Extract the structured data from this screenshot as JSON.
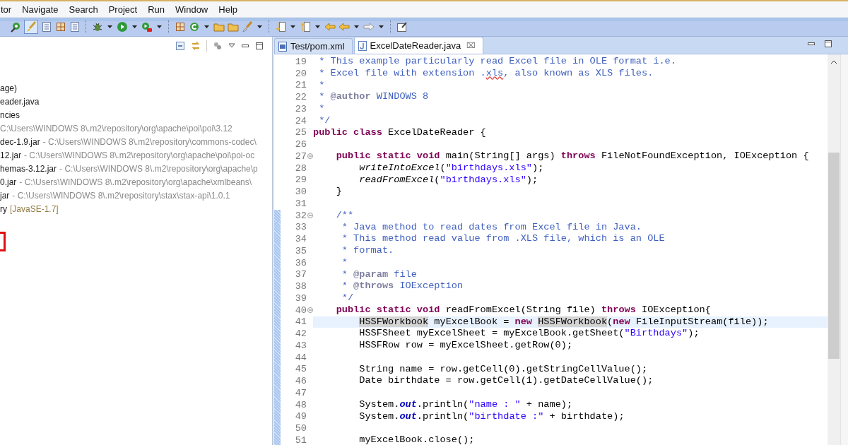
{
  "menu_bar": {
    "items": [
      "tor",
      "Navigate",
      "Search",
      "Project",
      "Run",
      "Window",
      "Help"
    ]
  },
  "project_explorer": {
    "items": [
      {
        "label": "age)"
      },
      {
        "label": "eader.java"
      },
      {
        "label": "ncies"
      },
      {
        "detail": "C:\\Users\\WINDOWS 8\\.m2\\repository\\org\\apache\\poi\\poi\\3.12",
        "kind": "path"
      },
      {
        "label": "dec-1.9.jar",
        "detail": "- C:\\Users\\WINDOWS 8\\.m2\\repository\\commons-codec\\",
        "kind": "path"
      },
      {
        "label": "12.jar",
        "detail": "- C:\\Users\\WINDOWS 8\\.m2\\repository\\org\\apache\\poi\\poi-oc",
        "kind": "path"
      },
      {
        "label": "hemas-3.12.jar",
        "detail": "- C:\\Users\\WINDOWS 8\\.m2\\repository\\org\\apache\\p",
        "kind": "path"
      },
      {
        "label": "0.jar",
        "detail": "- C:\\Users\\WINDOWS 8\\.m2\\repository\\org\\apache\\xmlbeans\\",
        "kind": "path"
      },
      {
        "label": "jar",
        "detail": "- C:\\Users\\WINDOWS 8\\.m2\\repository\\stax\\stax-api\\1.0.1",
        "kind": "path"
      },
      {
        "label": "ry",
        "detail": "[JavaSE-1.7]",
        "kind": "library"
      }
    ]
  },
  "editor": {
    "tabs": [
      {
        "label": "Test/pom.xml",
        "kind": "xml",
        "selected": false
      },
      {
        "label": "ExcelDateReader.java",
        "kind": "java",
        "selected": true,
        "close": "⌧"
      }
    ],
    "lines": [
      {
        "number": "19",
        "fold": false,
        "changed": false,
        "current": false,
        "tokens": [
          {
            "kind": "comment",
            "text": " * This example particularly read Excel file in OLE format i.e."
          }
        ]
      },
      {
        "number": "20",
        "fold": false,
        "changed": false,
        "current": false,
        "tokens": [
          {
            "kind": "comment",
            "text": " * Excel file with extension ."
          },
          {
            "kind": "misspelled",
            "text": "xls"
          },
          {
            "kind": "comment",
            "text": ", also known as XLS files."
          }
        ]
      },
      {
        "number": "21",
        "fold": false,
        "changed": false,
        "current": false,
        "tokens": [
          {
            "kind": "comment",
            "text": " *"
          }
        ]
      },
      {
        "number": "22",
        "fold": false,
        "changed": false,
        "current": false,
        "tokens": [
          {
            "kind": "comment",
            "text": " * "
          },
          {
            "kind": "doc_tag",
            "text": "@author"
          },
          {
            "kind": "comment",
            "text": " WINDOWS 8"
          }
        ]
      },
      {
        "number": "23",
        "fold": false,
        "changed": false,
        "current": false,
        "tokens": [
          {
            "kind": "comment",
            "text": " *"
          }
        ]
      },
      {
        "number": "24",
        "fold": false,
        "changed": false,
        "current": false,
        "tokens": [
          {
            "kind": "comment",
            "text": " */"
          }
        ]
      },
      {
        "number": "25",
        "fold": false,
        "changed": false,
        "current": false,
        "tokens": [
          {
            "kind": "keyword",
            "text": "public"
          },
          {
            "kind": "keyword",
            "text": " class"
          },
          {
            "kind": "plain",
            "text": " ExcelDateReader {"
          }
        ]
      },
      {
        "number": "26",
        "fold": false,
        "changed": false,
        "current": false
      },
      {
        "number": "27",
        "fold": true,
        "changed": false,
        "current": false,
        "tokens": [
          {
            "kind": "keyword",
            "text": "    public"
          },
          {
            "kind": "keyword",
            "text": " static"
          },
          {
            "kind": "keyword",
            "text": " void"
          },
          {
            "kind": "plain",
            "text": " main(String[] args) "
          },
          {
            "kind": "keyword",
            "text": "throws"
          },
          {
            "kind": "plain",
            "text": " FileNotFoundException, IOException {"
          }
        ]
      },
      {
        "number": "28",
        "fold": false,
        "changed": false,
        "current": false,
        "tokens": [
          {
            "kind": "static_call",
            "text": "        writeIntoExcel"
          },
          {
            "kind": "plain",
            "text": "("
          },
          {
            "kind": "string",
            "text": "\"birthdays.xls\""
          },
          {
            "kind": "plain",
            "text": ");"
          }
        ]
      },
      {
        "number": "29",
        "fold": false,
        "changed": false,
        "current": false,
        "tokens": [
          {
            "kind": "static_call",
            "text": "        readFromExcel"
          },
          {
            "kind": "plain",
            "text": "("
          },
          {
            "kind": "string",
            "text": "\"birthdays.xls\""
          },
          {
            "kind": "plain",
            "text": ");"
          }
        ]
      },
      {
        "number": "30",
        "fold": false,
        "changed": false,
        "current": false,
        "tokens": [
          {
            "kind": "plain",
            "text": "    }"
          }
        ]
      },
      {
        "number": "31",
        "fold": false,
        "changed": false,
        "current": false
      },
      {
        "number": "32",
        "fold": true,
        "changed": true,
        "current": false,
        "tokens": [
          {
            "kind": "comment",
            "text": "    /**"
          }
        ]
      },
      {
        "number": "33",
        "fold": false,
        "changed": true,
        "current": false,
        "tokens": [
          {
            "kind": "comment",
            "text": "     * Java method to read dates from Excel file in Java."
          }
        ]
      },
      {
        "number": "34",
        "fold": false,
        "changed": true,
        "current": false,
        "tokens": [
          {
            "kind": "comment",
            "text": "     * This method read value from .XLS file, which is an OLE"
          }
        ]
      },
      {
        "number": "35",
        "fold": false,
        "changed": true,
        "current": false,
        "tokens": [
          {
            "kind": "comment",
            "text": "     * format."
          }
        ]
      },
      {
        "number": "36",
        "fold": false,
        "changed": true,
        "current": false,
        "tokens": [
          {
            "kind": "comment",
            "text": "     *"
          }
        ]
      },
      {
        "number": "37",
        "fold": false,
        "changed": true,
        "current": false,
        "tokens": [
          {
            "kind": "comment",
            "text": "     * "
          },
          {
            "kind": "doc_tag",
            "text": "@param"
          },
          {
            "kind": "comment",
            "text": " file"
          }
        ]
      },
      {
        "number": "38",
        "fold": false,
        "changed": true,
        "current": false,
        "tokens": [
          {
            "kind": "comment",
            "text": "     * "
          },
          {
            "kind": "doc_tag",
            "text": "@throws"
          },
          {
            "kind": "comment",
            "text": " IOException"
          }
        ]
      },
      {
        "number": "39",
        "fold": false,
        "changed": true,
        "current": false,
        "tokens": [
          {
            "kind": "comment",
            "text": "     */"
          }
        ]
      },
      {
        "number": "40",
        "fold": true,
        "changed": true,
        "current": false,
        "tokens": [
          {
            "kind": "keyword",
            "text": "    public"
          },
          {
            "kind": "keyword",
            "text": " static"
          },
          {
            "kind": "keyword",
            "text": " void"
          },
          {
            "kind": "plain",
            "text": " readFromExcel(String file) "
          },
          {
            "kind": "keyword",
            "text": "throws"
          },
          {
            "kind": "plain",
            "text": " IOException{"
          }
        ]
      },
      {
        "number": "41",
        "fold": false,
        "changed": true,
        "current": true,
        "tokens": [
          {
            "kind": "occurrence",
            "text": "        HSSFWorkbook"
          },
          {
            "kind": "plain",
            "text": " myExcelBook = "
          },
          {
            "kind": "keyword",
            "text": "new"
          },
          {
            "kind": "occurrence",
            "text": " HSSFWorkbook"
          },
          {
            "kind": "plain",
            "text": "("
          },
          {
            "kind": "keyword",
            "text": "new"
          },
          {
            "kind": "plain",
            "text": " FileInputStream(file));"
          }
        ]
      },
      {
        "number": "42",
        "fold": false,
        "changed": true,
        "current": false,
        "tokens": [
          {
            "kind": "plain",
            "text": "        HSSFSheet myExcelSheet = myExcelBook.getSheet("
          },
          {
            "kind": "string",
            "text": "\"Birthdays\""
          },
          {
            "kind": "plain",
            "text": ");"
          }
        ]
      },
      {
        "number": "43",
        "fold": false,
        "changed": true,
        "current": false,
        "tokens": [
          {
            "kind": "plain",
            "text": "        HSSFRow row = myExcelSheet.getRow(0);"
          }
        ]
      },
      {
        "number": "44",
        "fold": false,
        "changed": true,
        "current": false
      },
      {
        "number": "45",
        "fold": false,
        "changed": true,
        "current": false,
        "tokens": [
          {
            "kind": "plain",
            "text": "        String name = row.getCell(0).getStringCellValue();"
          }
        ]
      },
      {
        "number": "46",
        "fold": false,
        "changed": true,
        "current": false,
        "tokens": [
          {
            "kind": "plain",
            "text": "        Date birthdate = row.getCell(1).getDateCellValue();"
          }
        ]
      },
      {
        "number": "47",
        "fold": false,
        "changed": true,
        "current": false
      },
      {
        "number": "48",
        "fold": false,
        "changed": true,
        "current": false,
        "tokens": [
          {
            "kind": "plain",
            "text": "        System."
          },
          {
            "kind": "field",
            "text": "out"
          },
          {
            "kind": "plain",
            "text": ".println("
          },
          {
            "kind": "string",
            "text": "\"name : \""
          },
          {
            "kind": "plain",
            "text": " + name);"
          }
        ]
      },
      {
        "number": "49",
        "fold": false,
        "changed": true,
        "current": false,
        "tokens": [
          {
            "kind": "plain",
            "text": "        System."
          },
          {
            "kind": "field",
            "text": "out"
          },
          {
            "kind": "plain",
            "text": ".println("
          },
          {
            "kind": "string",
            "text": "\"birthdate :\""
          },
          {
            "kind": "plain",
            "text": " + birthdate);"
          }
        ]
      },
      {
        "number": "50",
        "fold": false,
        "changed": true,
        "current": false
      },
      {
        "number": "51",
        "fold": false,
        "changed": true,
        "current": false,
        "tokens": [
          {
            "kind": "plain",
            "text": "        myExcelBook.close();"
          }
        ]
      }
    ]
  }
}
